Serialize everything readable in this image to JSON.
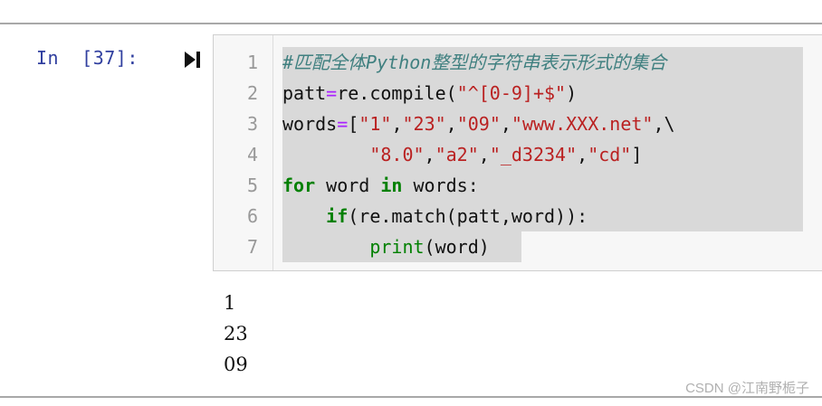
{
  "prompt": {
    "label": "In  [37]:"
  },
  "code_lines": [
    {
      "no": "1",
      "comment": "#匹配全体Python整型的字符串表示形式的集合"
    },
    {
      "no": "2",
      "t1": "patt",
      "t2": "=",
      "t3": "re.compile(",
      "t4": "\"^[0-9]+$\"",
      "t5": ")"
    },
    {
      "no": "3",
      "t1": "words",
      "t2": "=",
      "t3": "[",
      "s1": "\"1\"",
      "c1": ",",
      "s2": "\"23\"",
      "c2": ",",
      "s3": "\"09\"",
      "c3": ",",
      "s4": "\"www.XXX.net\"",
      "c4": ",\\"
    },
    {
      "no": "4",
      "s1": "\"8.0\"",
      "c1": ",",
      "s2": "\"a2\"",
      "c2": ",",
      "s3": "\"_d3234\"",
      "c3": ",",
      "s4": "\"cd\"",
      "c4": "]"
    },
    {
      "no": "5",
      "k1": "for",
      "t1": " word ",
      "k2": "in",
      "t2": " words:"
    },
    {
      "no": "6",
      "k1": "if",
      "t1": "(re.match(patt,word)):"
    },
    {
      "no": "7",
      "b1": "print",
      "t1": "(word)"
    }
  ],
  "output_lines": [
    "1",
    "23",
    "09"
  ],
  "watermark": "CSDN @江南野栀子",
  "colors": {
    "prompt": "#303f9f",
    "keyword": "#008000",
    "string": "#ba2121",
    "operator": "#aa22ff",
    "comment": "#408080"
  },
  "icons": {
    "run": "run-cell-icon"
  }
}
